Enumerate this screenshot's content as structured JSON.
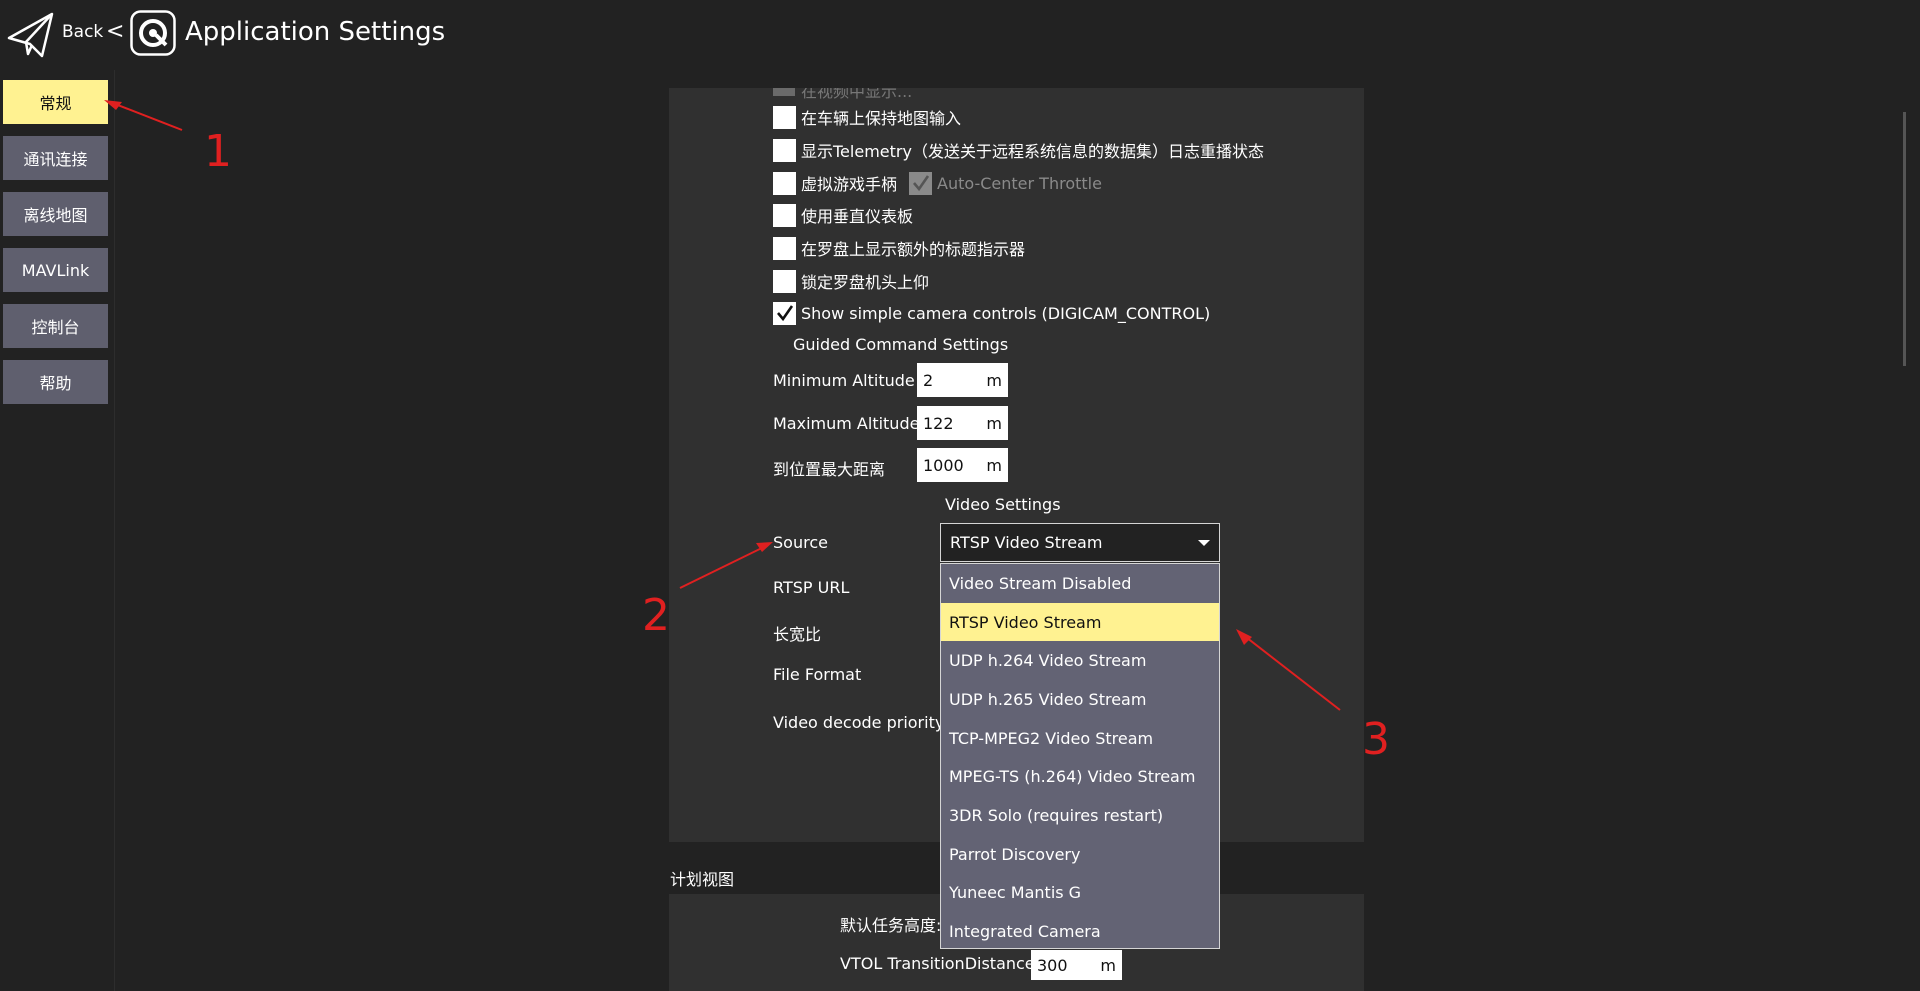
{
  "header": {
    "back_label": "Back",
    "back_chevron": "<",
    "title": "Application Settings",
    "back_icon": "paper-plane-icon",
    "logo_icon": "qgc-logo-icon"
  },
  "sidebar": {
    "items": [
      {
        "label": "常规",
        "active": true
      },
      {
        "label": "通讯连接"
      },
      {
        "label": "离线地图"
      },
      {
        "label": "MAVLink"
      },
      {
        "label": "控制台"
      },
      {
        "label": "帮助"
      }
    ]
  },
  "general": {
    "cut_label": "在视频中显示...",
    "checkboxes": [
      {
        "label": "在车辆上保持地图输入",
        "checked": false
      },
      {
        "label": "显示Telemetry（发送关于远程系统信息的数据集）日志重播状态",
        "checked": false
      },
      {
        "label": "虚拟游戏手柄",
        "checked": false
      },
      {
        "label": "使用垂直仪表板",
        "checked": false
      },
      {
        "label": "在罗盘上显示额外的标题指示器",
        "checked": false
      },
      {
        "label": "锁定罗盘机头上仰",
        "checked": false
      },
      {
        "label": "Show simple camera controls (DIGICAM_CONTROL)",
        "checked": true
      }
    ],
    "auto_center_throttle": "Auto-Center Throttle"
  },
  "guided": {
    "title": "Guided Command Settings",
    "min_alt_label": "Minimum Altitude",
    "min_alt_value": "2",
    "max_alt_label": "Maximum Altitude",
    "max_alt_value": "122",
    "max_dist_label": "到位置最大距离",
    "max_dist_value": "1000",
    "unit": "m"
  },
  "video": {
    "title": "Video Settings",
    "source_label": "Source",
    "source_value": "RTSP Video Stream",
    "rtsp_url_label": "RTSP URL",
    "aspect_label": "长宽比",
    "file_format_label": "File Format",
    "decode_label": "Video decode priority",
    "options": [
      "Video Stream Disabled",
      "RTSP Video Stream",
      "UDP h.264 Video Stream",
      "UDP h.265 Video Stream",
      "TCP-MPEG2 Video Stream",
      "MPEG-TS (h.264) Video Stream",
      "3DR Solo (requires restart)",
      "Parrot Discovery",
      "Yuneec Mantis G",
      "Integrated Camera"
    ],
    "selected_index": 1
  },
  "plan": {
    "title": "计划视图",
    "default_alt_label": "默认任务高度:",
    "vtol_label": "VTOL TransitionDistance",
    "vtol_value": "300",
    "unit": "m"
  },
  "annotations": {
    "one": "1",
    "two": "2",
    "three": "3",
    "color": "#e02020"
  }
}
